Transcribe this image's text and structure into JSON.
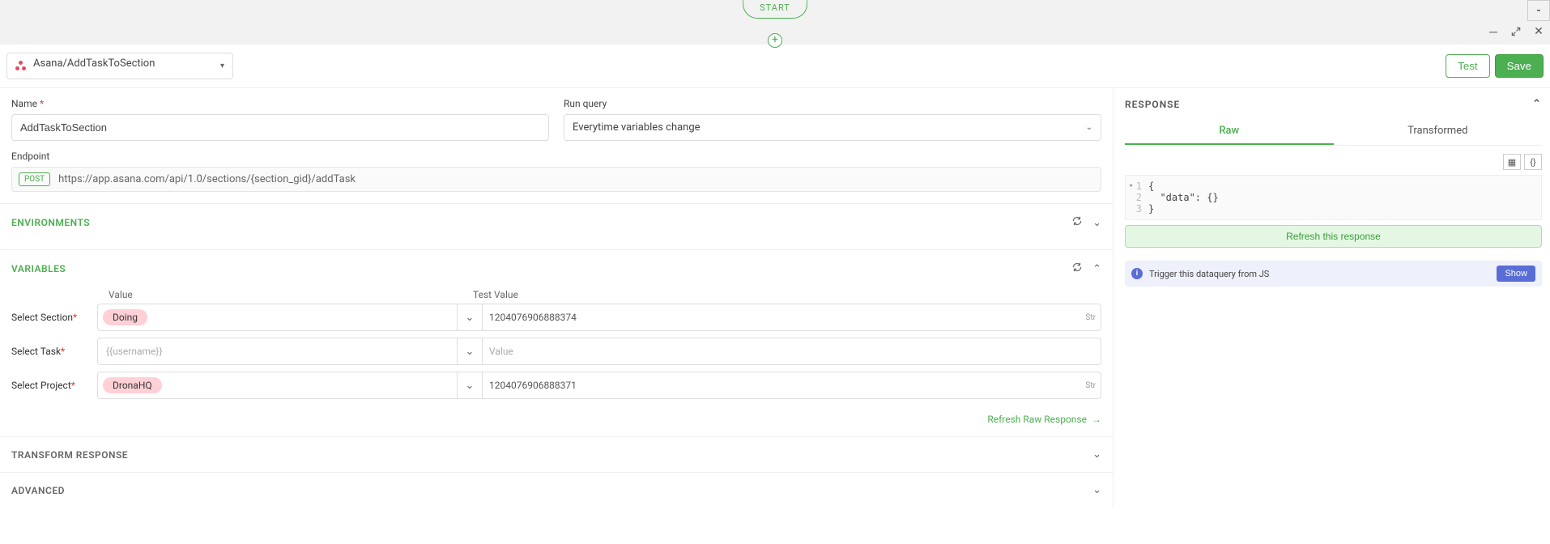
{
  "header": {
    "start_label": "START"
  },
  "toolbar": {
    "service_label": "Asana/AddTaskToSection",
    "test_label": "Test",
    "save_label": "Save"
  },
  "form": {
    "name_label": "Name",
    "name_value": "AddTaskToSection",
    "runquery_label": "Run query",
    "runquery_value": "Everytime variables change",
    "endpoint_label": "Endpoint",
    "endpoint_method": "POST",
    "endpoint_url": "https://app.asana.com/api/1.0/sections/{section_gid}/addTask"
  },
  "sections": {
    "environments": "ENVIRONMENTS",
    "variables": "VARIABLES",
    "transform_response": "TRANSFORM RESPONSE",
    "advanced": "ADVANCED"
  },
  "variables": {
    "col_value": "Value",
    "col_test": "Test Value",
    "rows": [
      {
        "name": "Select Section",
        "tag": "Doing",
        "placeholder": "",
        "test_value": "1204076906888374",
        "type": "Str"
      },
      {
        "name": "Select Task",
        "tag": "",
        "placeholder": "{{username}}",
        "test_value": "",
        "test_placeholder": "Value",
        "type": ""
      },
      {
        "name": "Select Project",
        "tag": "DronaHQ",
        "placeholder": "",
        "test_value": "1204076906888371",
        "type": "Str"
      }
    ],
    "refresh_link": "Refresh Raw Response"
  },
  "response": {
    "title": "RESPONSE",
    "tab_raw": "Raw",
    "tab_transformed": "Transformed",
    "code_lines": [
      "{",
      "  \"data\": {}",
      "}"
    ],
    "refresh_label": "Refresh this response",
    "trigger_text": "Trigger this dataquery from JS",
    "show_label": "Show"
  }
}
